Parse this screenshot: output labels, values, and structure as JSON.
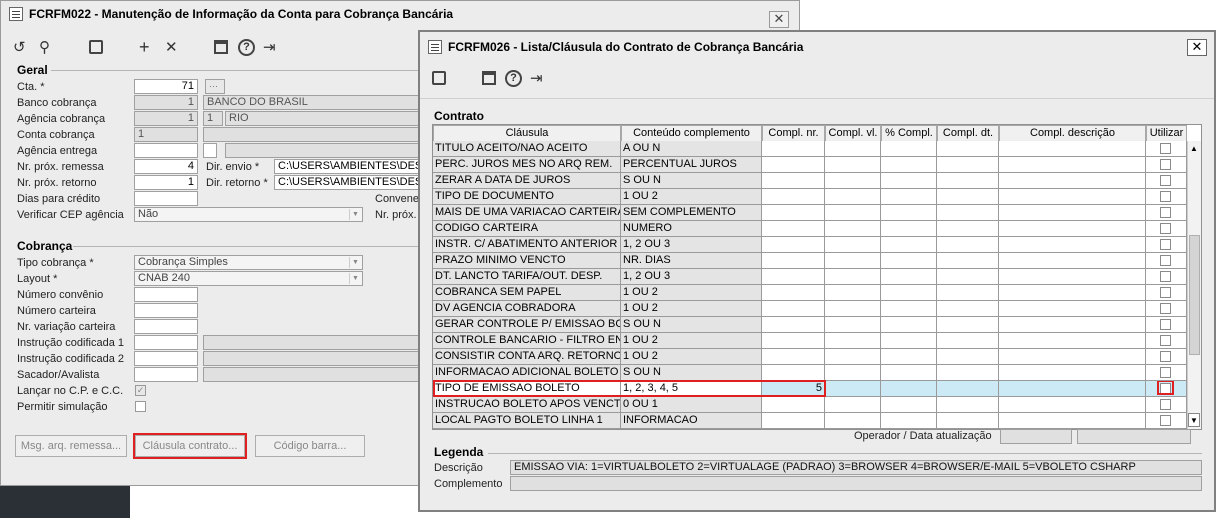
{
  "back_window": {
    "title": "FCRFM022 - Manutenção de Informação da Conta para Cobrança Bancária",
    "close": "✕",
    "toolbar": {
      "undo": "↺",
      "search": "⚲",
      "save": "💾",
      "add": "+",
      "delete": "✕",
      "calendar": "📅",
      "help": "?",
      "exit": "⇥"
    },
    "geral": {
      "title": "Geral",
      "cta_label": "Cta. *",
      "cta": "71",
      "banco_label": "Banco cobrança",
      "banco_code": "1",
      "banco_name": "BANCO DO BRASIL",
      "agencia_label": "Agência cobrança",
      "agencia_code": "1",
      "agencia_code2": "1",
      "agencia_name": "RIO",
      "conta_label": "Conta cobrança",
      "conta": "1",
      "agencia_entrega_label": "Agência entrega",
      "nr_remessa_label": "Nr. próx. remessa",
      "nr_remessa": "4",
      "nr_retorno_label": "Nr. próx. retorno",
      "nr_retorno": "1",
      "dias_credito_label": "Dias para crédito",
      "verificar_cep_label": "Verificar CEP agência",
      "verificar_cep": "Não",
      "dir_envio_label": "Dir. envio *",
      "dir_envio": "C:\\USERS\\AMBIENTES\\DESKT",
      "dir_retorno_label": "Dir. retorno *",
      "dir_retorno": "C:\\USERS\\AMBIENTES\\DESKT",
      "convenio_label": "Convene",
      "nr_prox_label": "Nr. próx."
    },
    "cobranca": {
      "title": "Cobrança",
      "tipo_label": "Tipo cobrança *",
      "tipo": "Cobrança Simples",
      "layout_label": "Layout *",
      "layout": "CNAB 240",
      "numero_convenio_label": "Número convênio",
      "numero_carteira_label": "Número carteira",
      "variacao_label": "Nr. variação carteira",
      "instrucao1_label": "Instrução codificada 1",
      "instrucao2_label": "Instrução codificada 2",
      "sacador_label": "Sacador/Avalista",
      "lancar_label": "Lançar no C.P. e C.C.",
      "permitir_label": "Permitir simulação"
    },
    "buttons": {
      "msg": "Msg. arq. remessa...",
      "clausula": "Cláusula contrato...",
      "codigo": "Código barra..."
    }
  },
  "front_window": {
    "title": "FCRFM026 - Lista/Cláusula do Contrato de Cobrança Bancária",
    "close": "✕",
    "toolbar": {
      "save": "💾",
      "calendar": "📅",
      "help": "?",
      "exit": "⇥"
    },
    "contrato_title": "Contrato",
    "columns": [
      "Cláusula",
      "Conteúdo complemento",
      "Compl. nr.",
      "Compl. vl.",
      "% Compl.",
      "Compl. dt.",
      "Compl. descrição",
      "Utilizar"
    ],
    "rows": [
      {
        "clausula": "TITULO ACEITO/NAO ACEITO",
        "conteudo": "A OU N",
        "nr": ""
      },
      {
        "clausula": "PERC. JUROS MES NO ARQ REM.",
        "conteudo": "PERCENTUAL JUROS",
        "nr": ""
      },
      {
        "clausula": "ZERAR A DATA DE JUROS",
        "conteudo": "S OU N",
        "nr": ""
      },
      {
        "clausula": "TIPO DE DOCUMENTO",
        "conteudo": "1 OU 2",
        "nr": ""
      },
      {
        "clausula": "MAIS DE UMA VARIACAO CARTEIRA",
        "conteudo": "SEM COMPLEMENTO",
        "nr": ""
      },
      {
        "clausula": "CODIGO CARTEIRA",
        "conteudo": "NUMERO",
        "nr": ""
      },
      {
        "clausula": "INSTR. C/ ABATIMENTO ANTERIOR",
        "conteudo": "1, 2 OU 3",
        "nr": ""
      },
      {
        "clausula": "PRAZO MINIMO VENCTO",
        "conteudo": "NR. DIAS",
        "nr": ""
      },
      {
        "clausula": "DT. LANCTO TARIFA/OUT. DESP.",
        "conteudo": "1, 2 OU 3",
        "nr": ""
      },
      {
        "clausula": "COBRANCA SEM PAPEL",
        "conteudo": "1 OU 2",
        "nr": ""
      },
      {
        "clausula": "DV AGENCIA COBRADORA",
        "conteudo": "1 OU 2",
        "nr": ""
      },
      {
        "clausula": "GERAR CONTROLE P/ EMISSAO BCO",
        "conteudo": "S OU N",
        "nr": ""
      },
      {
        "clausula": "CONTROLE BANCARIO - FILTRO ENV",
        "conteudo": "1 OU 2",
        "nr": ""
      },
      {
        "clausula": "CONSISTIR CONTA ARQ. RETORNO",
        "conteudo": "1 OU 2",
        "nr": ""
      },
      {
        "clausula": "INFORMACAO ADICIONAL BOLETO",
        "conteudo": "S OU N",
        "nr": ""
      },
      {
        "clausula": "TIPO DE EMISSAO BOLETO",
        "conteudo": "1, 2,  3, 4, 5",
        "nr": "5"
      },
      {
        "clausula": "INSTRUCAO BOLETO APOS VENCTO",
        "conteudo": "0 OU 1",
        "nr": ""
      },
      {
        "clausula": "LOCAL PAGTO BOLETO LINHA 1",
        "conteudo": "INFORMACAO",
        "nr": ""
      }
    ],
    "operador_label": "Operador / Data atualização",
    "legenda_title": "Legenda",
    "descricao_label": "Descrição",
    "descricao": "EMISSAO VIA: 1=VIRTUALBOLETO 2=VIRTUALAGE (PADRAO) 3=BROWSER 4=BROWSER/E-MAIL  5=VBOLETO CSHARP",
    "complemento_label": "Complemento",
    "scroll_up": "▲",
    "scroll_down": "▼"
  },
  "colors": {
    "highlight": "#e02020",
    "selected_row": "#cbeaf6",
    "window_bg": "#ececec"
  }
}
